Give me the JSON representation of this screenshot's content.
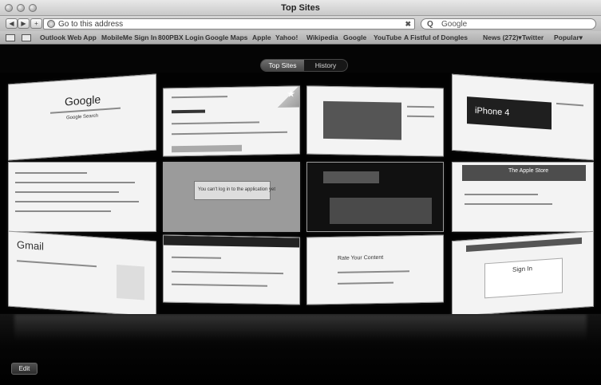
{
  "window": {
    "title": "Top Sites"
  },
  "toolbar": {
    "back": "◀",
    "forward": "▶",
    "add": "+",
    "address_placeholder": "Go to this address",
    "clear": "✖",
    "search_icon": "Q",
    "search_text": "Google"
  },
  "bookmarks": [
    "Outlook Web App",
    "MobileMe Sign In",
    "800PBX Login",
    "Google Maps",
    "Apple",
    "Yahoo!",
    "Wikipedia",
    "Google",
    "YouTube",
    "A Fistful of Dongles",
    "News (272)▾",
    "Twitter",
    "Popular▾"
  ],
  "view_toggle": {
    "top_sites": "Top Sites",
    "history": "History"
  },
  "thumbnails": {
    "google_home": "Google",
    "google_search_button": "Google Search",
    "sign_in": "Sign In",
    "iphone": "iPhone 4",
    "apple_store": "The Apple Store",
    "gmail": "Gmail",
    "rate_content": "Rate Your Content",
    "error_text": "You can't log in to the application yet"
  },
  "edit_button": "Edit"
}
